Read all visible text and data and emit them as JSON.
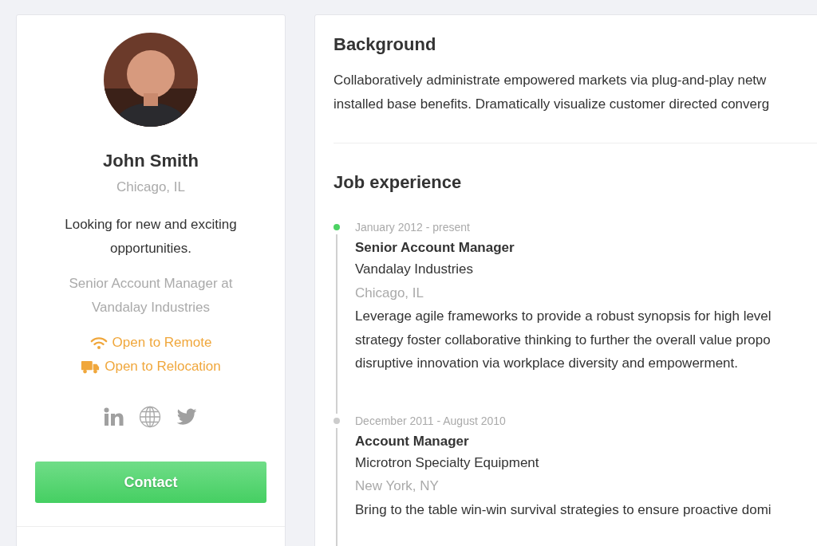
{
  "profile": {
    "name": "John Smith",
    "location": "Chicago, IL",
    "tagline": "Looking for new and exciting opportunities.",
    "position": "Senior Account Manager at Vandalay Industries",
    "preferences": [
      {
        "kind": "remote",
        "label": "Open to Remote"
      },
      {
        "kind": "relocation",
        "label": "Open to Relocation"
      }
    ],
    "social_links": [
      {
        "kind": "linkedin"
      },
      {
        "kind": "website"
      },
      {
        "kind": "twitter"
      }
    ],
    "contact_button": "Contact"
  },
  "background": {
    "heading": "Background",
    "lines": [
      "Collaboratively administrate empowered markets via plug-and-play netw",
      "installed base benefits. Dramatically visualize customer directed converg"
    ]
  },
  "job_experience": {
    "heading": "Job experience",
    "jobs": [
      {
        "current": true,
        "dates": "January 2012 - present",
        "title": "Senior Account Manager",
        "company": "Vandalay Industries",
        "location": "Chicago, IL",
        "description": [
          "Leverage agile frameworks to provide a robust synopsis for high level",
          "strategy foster collaborative thinking to further the overall value propo",
          "disruptive innovation via workplace diversity and empowerment."
        ]
      },
      {
        "current": false,
        "dates": "December 2011 - August 2010",
        "title": "Account Manager",
        "company": "Microtron Specialty Equipment",
        "location": "New York, NY",
        "description": [
          "Bring to the table win-win survival strategies to ensure proactive domi"
        ]
      }
    ]
  }
}
